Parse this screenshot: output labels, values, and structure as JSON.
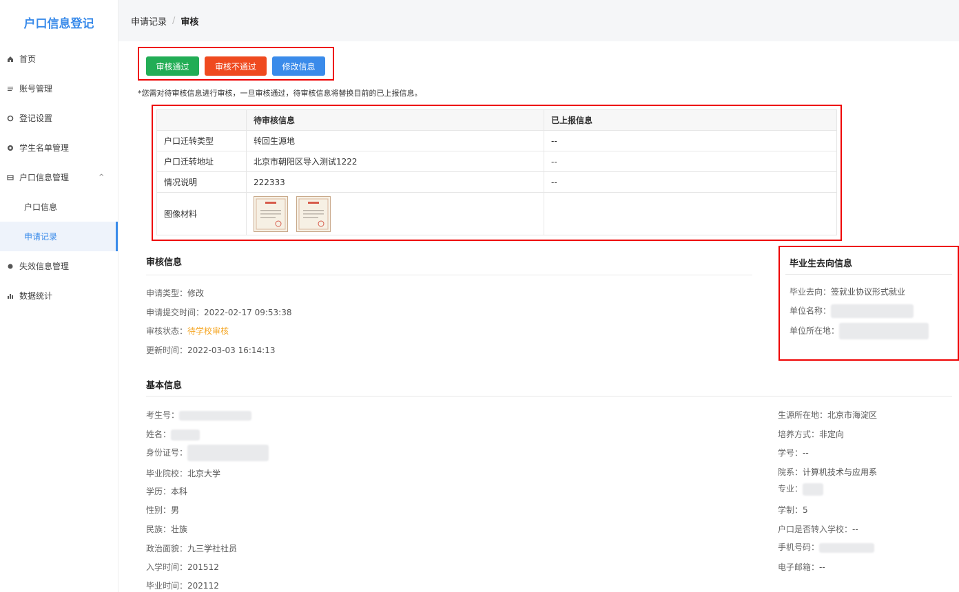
{
  "app": {
    "title": "户口信息登记"
  },
  "sidebar": {
    "items": [
      {
        "label": "首页",
        "icon": "home-icon"
      },
      {
        "label": "账号管理",
        "icon": "list-icon"
      },
      {
        "label": "登记设置",
        "icon": "settings-icon"
      },
      {
        "label": "学生名单管理",
        "icon": "users-icon"
      },
      {
        "label": "户口信息管理",
        "icon": "folder-icon",
        "expanded": true,
        "children": [
          {
            "label": "户口信息"
          },
          {
            "label": "申请记录",
            "active": true
          }
        ]
      },
      {
        "label": "失效信息管理",
        "icon": "dot-icon"
      },
      {
        "label": "数据统计",
        "icon": "chart-icon"
      }
    ]
  },
  "breadcrumb": {
    "parent": "申请记录",
    "separator": "/",
    "current": "审核"
  },
  "actions": {
    "approve": "审核通过",
    "reject": "审核不通过",
    "edit": "修改信息"
  },
  "notice": "*您需对待审核信息进行审核，一旦审核通过，待审核信息将替换目前的已上报信息。",
  "compare": {
    "headers": [
      "",
      "待审核信息",
      "已上报信息"
    ],
    "rows": [
      {
        "label": "户口迁转类型",
        "pending": "转回生源地",
        "reported": "--"
      },
      {
        "label": "户口迁转地址",
        "pending": "北京市朝阳区导入测试1222",
        "reported": "--"
      },
      {
        "label": "情况说明",
        "pending": "222333",
        "reported": "--"
      }
    ],
    "image_row_label": "图像材料"
  },
  "audit": {
    "title": "审核信息",
    "type_label": "申请类型：",
    "type_value": "修改",
    "submit_label": "申请提交时间：",
    "submit_value": "2022-02-17 09:53:38",
    "status_label": "审核状态：",
    "status_value": "待学校审核",
    "update_label": "更新时间：",
    "update_value": "2022-03-03 16:14:13"
  },
  "destination": {
    "title": "毕业生去向信息",
    "dest_label": "毕业去向：",
    "dest_value": "签就业协议形式就业",
    "unit_label": "单位名称：",
    "loc_label": "单位所在地："
  },
  "basic": {
    "title": "基本信息",
    "left": {
      "exam_no_label": "考生号：",
      "name_label": "姓名：",
      "id_label": "身份证号：",
      "school_label": "毕业院校：",
      "school_value": "北京大学",
      "edu_label": "学历：",
      "edu_value": "本科",
      "gender_label": "性别：",
      "gender_value": "男",
      "ethnic_label": "民族：",
      "ethnic_value": "壮族",
      "political_label": "政治面貌：",
      "political_value": "九三学社社员",
      "enroll_label": "入学时间：",
      "enroll_value": "201512",
      "grad_label": "毕业时间：",
      "grad_value": "202112"
    },
    "right": {
      "origin_label": "生源所在地：",
      "origin_value": "北京市海淀区",
      "training_label": "培养方式：",
      "training_value": "非定向",
      "stuno_label": "学号：",
      "stuno_value": "--",
      "dept_label": "院系：",
      "dept_value": "计算机技术与应用系",
      "major_label": "专业：",
      "years_label": "学制：",
      "years_value": "5",
      "hukou_label": "户口是否转入学校：",
      "hukou_value": "--",
      "phone_label": "手机号码：",
      "email_label": "电子邮箱：",
      "email_value": "--"
    }
  },
  "colors": {
    "primary": "#3a8bea",
    "success": "#22ad55",
    "danger": "#ef4a1f",
    "warning": "#f5a623",
    "highlight": "#e00000"
  }
}
